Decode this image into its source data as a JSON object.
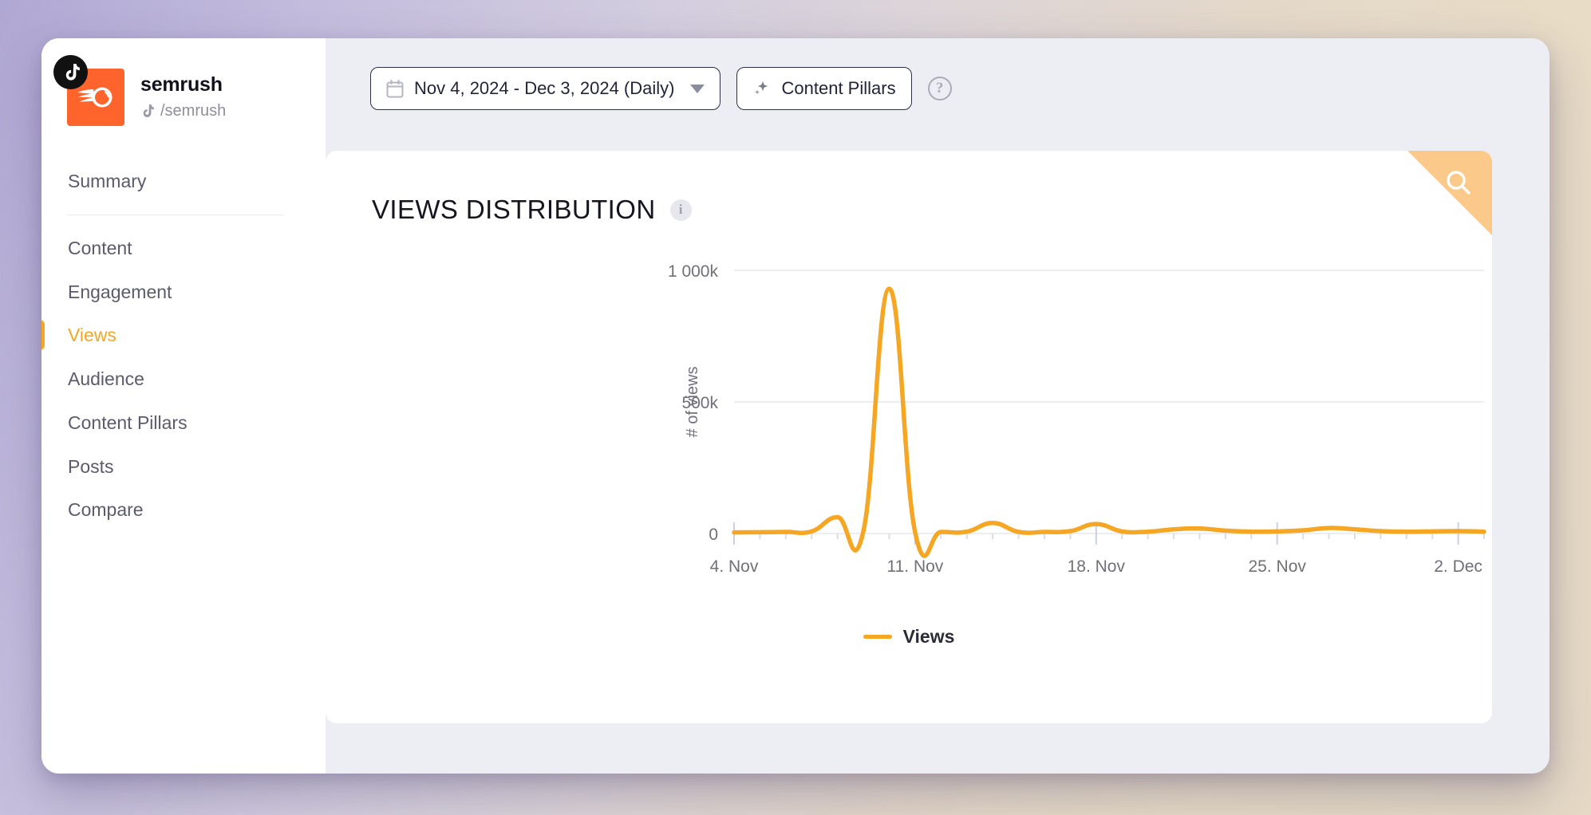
{
  "background": {
    "gradient_from": "#b0a8d4",
    "gradient_to": "#e8dcc6"
  },
  "accent_color": "#f5a623",
  "sidebar": {
    "profile": {
      "name": "semrush",
      "handle": "/semrush",
      "platform_icon": "tiktok-icon",
      "avatar_icon": "semrush-logo-icon",
      "avatar_color": "#ff642d"
    },
    "items": [
      {
        "label": "Summary",
        "active": false,
        "name": "sidebar-item-summary"
      },
      {
        "label": "Content",
        "active": false,
        "name": "sidebar-item-content"
      },
      {
        "label": "Engagement",
        "active": false,
        "name": "sidebar-item-engagement"
      },
      {
        "label": "Views",
        "active": true,
        "name": "sidebar-item-views"
      },
      {
        "label": "Audience",
        "active": false,
        "name": "sidebar-item-audience"
      },
      {
        "label": "Content Pillars",
        "active": false,
        "name": "sidebar-item-content-pillars"
      },
      {
        "label": "Posts",
        "active": false,
        "name": "sidebar-item-posts"
      },
      {
        "label": "Compare",
        "active": false,
        "name": "sidebar-item-compare"
      }
    ]
  },
  "toolbar": {
    "date_range_label": "Nov 4, 2024 - Dec 3, 2024 (Daily)",
    "date_range_icon": "calendar-icon",
    "content_pillars_label": "Content Pillars",
    "content_pillars_icon": "sparkle-icon",
    "help_label": "?",
    "help_icon": "question-mark-circle-icon"
  },
  "card": {
    "title": "VIEWS DISTRIBUTION",
    "info_label": "i",
    "info_icon": "info-circle-icon",
    "search_icon": "search-icon",
    "ribbon_color": "#fbca8a"
  },
  "chart_data": {
    "type": "line",
    "title": "VIEWS DISTRIBUTION",
    "xlabel": "",
    "ylabel": "# of views",
    "ylim": [
      0,
      1000000
    ],
    "yticks": [
      0,
      500000,
      1000000
    ],
    "ytick_labels": [
      "0",
      "500k",
      "1 000k"
    ],
    "xtick_labels": [
      "4. Nov",
      "11. Nov",
      "18. Nov",
      "25. Nov",
      "2. Dec"
    ],
    "xtick_indices": [
      0,
      7,
      14,
      21,
      28
    ],
    "grid": true,
    "legend": [
      {
        "name": "Views",
        "color": "#f5a623"
      }
    ],
    "series": [
      {
        "name": "Views",
        "color": "#f5a623",
        "x": [
          "4. Nov",
          "5. Nov",
          "6. Nov",
          "7. Nov",
          "8. Nov",
          "9. Nov",
          "10. Nov",
          "11. Nov",
          "12. Nov",
          "13. Nov",
          "14. Nov",
          "15. Nov",
          "16. Nov",
          "17. Nov",
          "18. Nov",
          "19. Nov",
          "20. Nov",
          "21. Nov",
          "22. Nov",
          "23. Nov",
          "24. Nov",
          "25. Nov",
          "26. Nov",
          "27. Nov",
          "28. Nov",
          "29. Nov",
          "30. Nov",
          "1. Dec",
          "2. Dec",
          "3. Dec"
        ],
        "values": [
          4000,
          5000,
          6000,
          8000,
          62000,
          9000,
          930000,
          5000,
          6000,
          7000,
          40000,
          6000,
          6000,
          9000,
          36000,
          8000,
          7000,
          16000,
          19000,
          11000,
          7000,
          8000,
          12000,
          21000,
          16000,
          9000,
          7000,
          8000,
          9000,
          7000
        ]
      }
    ]
  }
}
